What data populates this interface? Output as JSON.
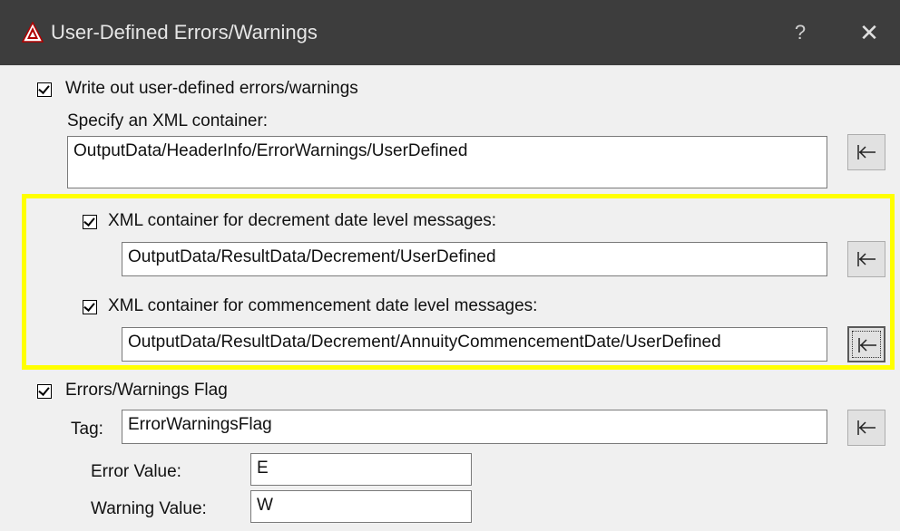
{
  "window": {
    "title": "User-Defined Errors/Warnings",
    "help_label": "?",
    "close_label": "✕",
    "icon": "app-logo-icon"
  },
  "write_out": {
    "checkbox_label": "Write out user-defined errors/warnings",
    "checked": true,
    "container_label": "Specify an XML container:",
    "container_value": "OutputData/HeaderInfo/ErrorWarnings/UserDefined",
    "browse_icon": "insert-path-icon"
  },
  "decrement": {
    "checkbox_label": "XML container for decrement date level messages:",
    "checked": true,
    "value": "OutputData/ResultData/Decrement/UserDefined"
  },
  "commencement": {
    "checkbox_label": "XML container for commencement date level messages:",
    "checked": true,
    "value": "OutputData/ResultData/Decrement/AnnuityCommencementDate/UserDefined"
  },
  "flag": {
    "checkbox_label": "Errors/Warnings Flag",
    "checked": true,
    "tag_label": "Tag:",
    "tag_value": "ErrorWarningsFlag",
    "error_label": "Error Value:",
    "error_value": "E",
    "warning_label": "Warning Value:",
    "warning_value": "W"
  },
  "colors": {
    "titlebar": "#3d3d3d",
    "highlight": "#ffff00",
    "client_bg": "#f0f0f0"
  }
}
